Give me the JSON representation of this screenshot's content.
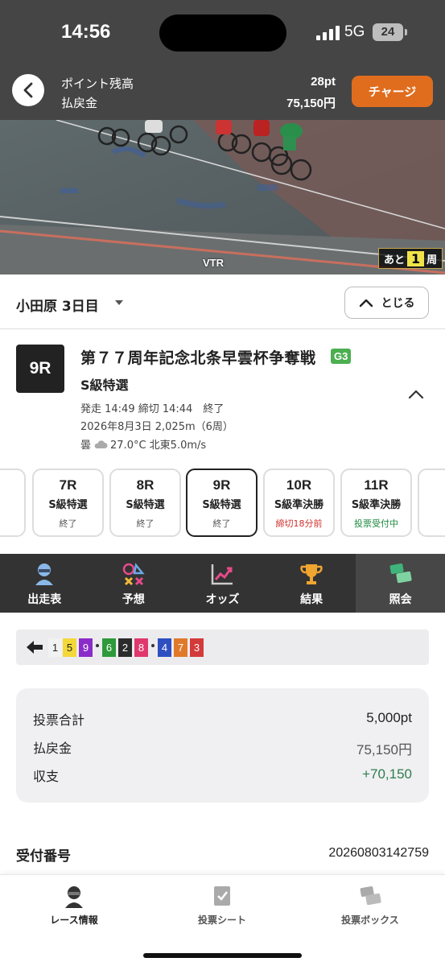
{
  "status": {
    "time": "14:56",
    "network": "5G",
    "battery": "24"
  },
  "header": {
    "points_label": "ポイント残高",
    "points_value": "28pt",
    "refund_label": "払戻金",
    "refund_value": "75,150円",
    "charge_label": "チャージ"
  },
  "video": {
    "vtr_label": "VTR",
    "lap_prefix": "あと",
    "lap_count": "1",
    "lap_suffix": "周"
  },
  "venue": {
    "name": "小田原 3日目",
    "close_label": "とじる"
  },
  "race": {
    "number": "9R",
    "title": "第７７周年記念北条早雲杯争奪戦",
    "grade": "G3",
    "class": "S級特選",
    "times": "発走 14:49 締切 14:44　終了",
    "date_distance": "2026年8月3日 2,025m（6周）",
    "weather": "曇",
    "weather_detail": "27.0°C 北東5.0m/s"
  },
  "race_tabs": [
    {
      "no": "7R",
      "cls": "S級特選",
      "status": "終了",
      "status_color": "gray"
    },
    {
      "no": "8R",
      "cls": "S級特選",
      "status": "終了",
      "status_color": "gray"
    },
    {
      "no": "9R",
      "cls": "S級特選",
      "status": "終了",
      "status_color": "gray",
      "active": true
    },
    {
      "no": "10R",
      "cls": "S級準決勝",
      "status": "締切18分前",
      "status_color": "red"
    },
    {
      "no": "11R",
      "cls": "S級準決勝",
      "status": "投票受付中",
      "status_color": "green"
    }
  ],
  "nav_tabs": [
    {
      "label": "出走表",
      "icon": "rider-icon"
    },
    {
      "label": "予想",
      "icon": "prediction-icon"
    },
    {
      "label": "オッズ",
      "icon": "odds-chart-icon"
    },
    {
      "label": "結果",
      "icon": "trophy-icon"
    },
    {
      "label": "照会",
      "icon": "tickets-icon",
      "active": true
    }
  ],
  "line_formation": {
    "numbers": [
      "1",
      "5",
      "9",
      "6",
      "2",
      "8",
      "4",
      "7",
      "3"
    ],
    "colors": {
      "1": "#f2f2f2",
      "5": "#f3d83a",
      "9": "#8a2cc9",
      "6": "#2e9a3a",
      "2": "#2b2b2b",
      "8": "#e0386e",
      "4": "#2f4fc1",
      "7": "#e07a2a",
      "3": "#d33a3a"
    }
  },
  "summary": {
    "bet_total_label": "投票合計",
    "bet_total_value": "5,000pt",
    "refund_label": "払戻金",
    "refund_value": "75,150円",
    "balance_label": "収支",
    "balance_value": "+70,150"
  },
  "receipt": {
    "label": "受付番号",
    "value": "20260803142759"
  },
  "bottom_nav": [
    {
      "label": "レース情報",
      "icon": "race-info-icon",
      "active": true
    },
    {
      "label": "投票シート",
      "icon": "vote-sheet-icon"
    },
    {
      "label": "投票ボックス",
      "icon": "vote-box-icon"
    }
  ]
}
